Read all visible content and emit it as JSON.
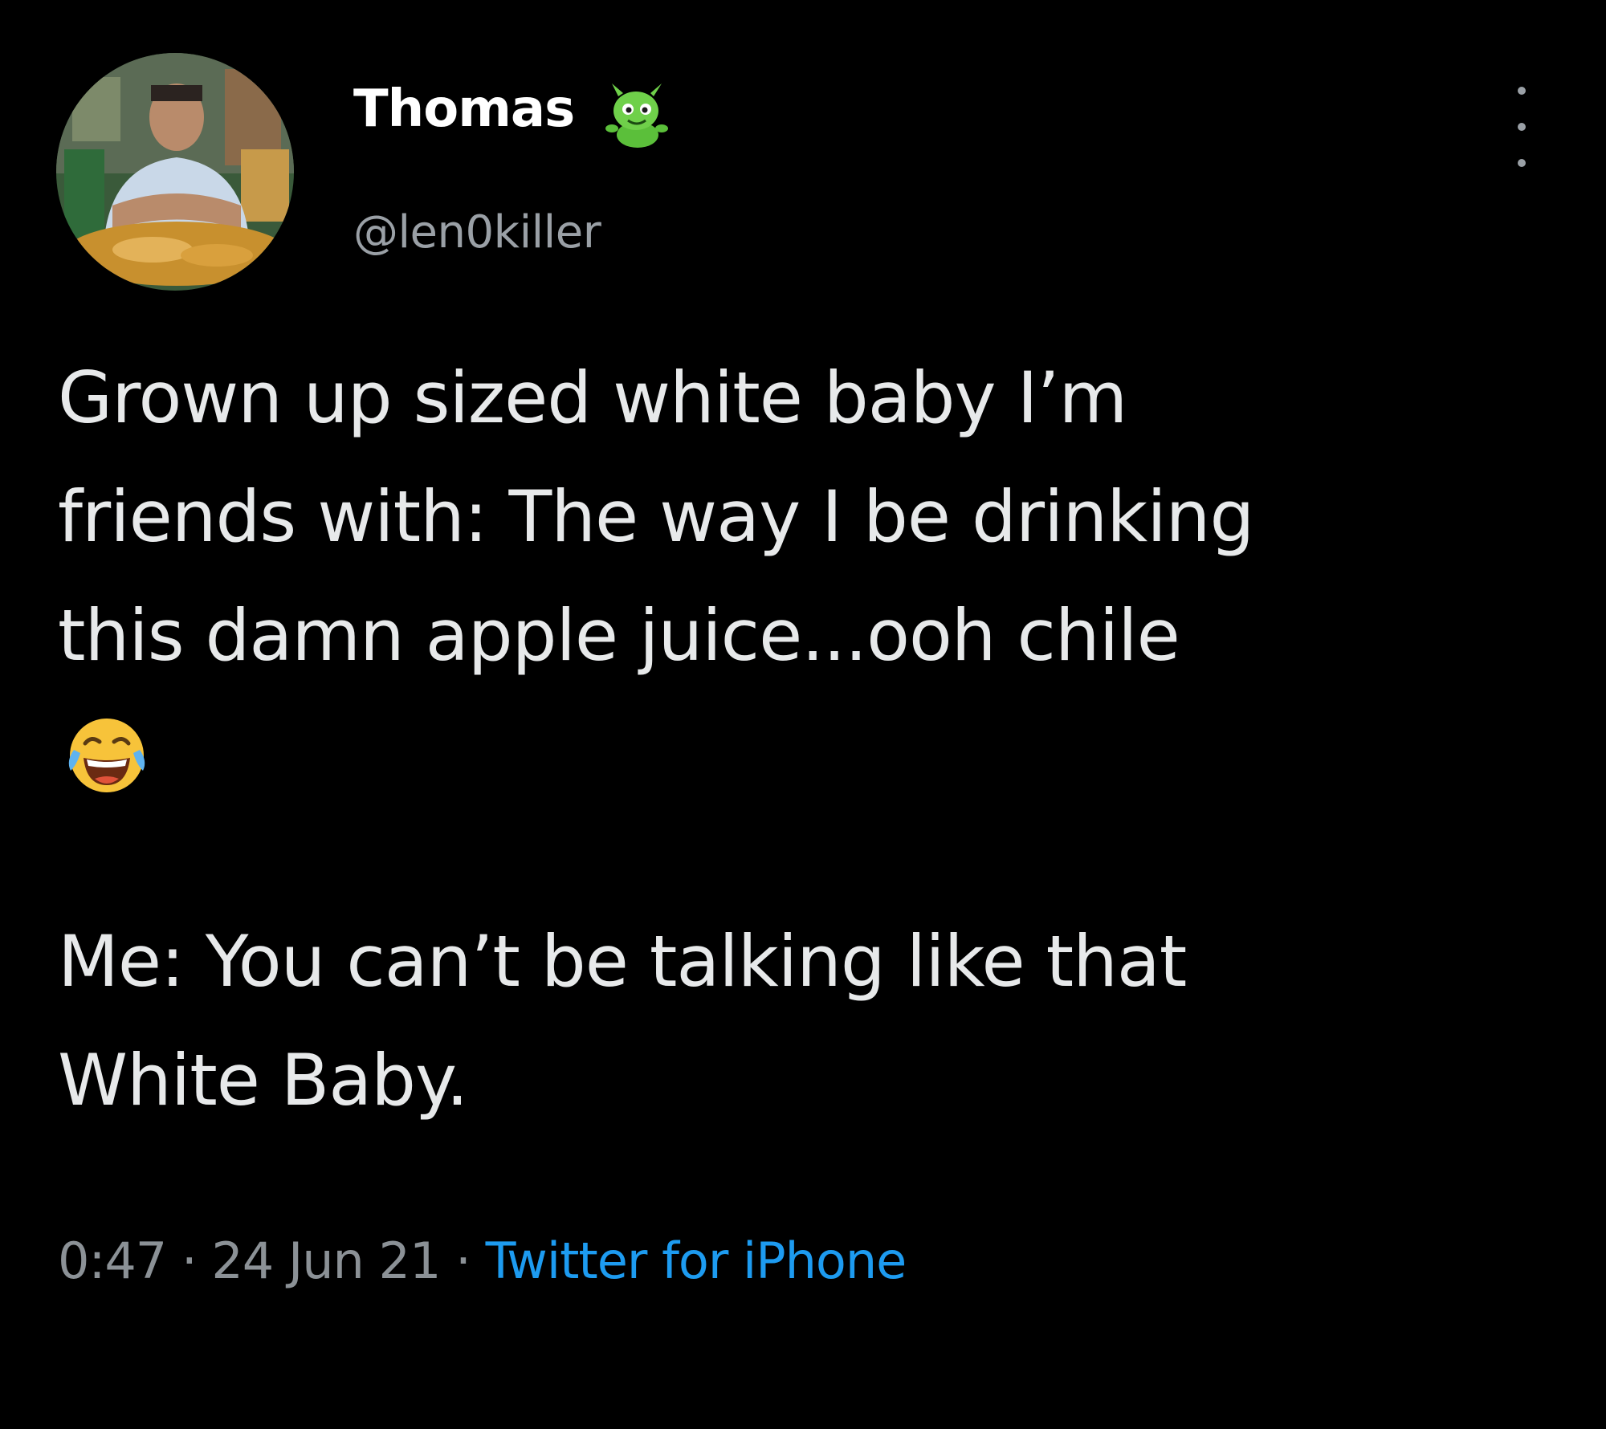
{
  "author": {
    "display_name": "Thomas",
    "handle": "@len0killer",
    "name_emoji": "alien-monster-emoji",
    "avatar": "profile-photo"
  },
  "tweet": {
    "lines_part1": [
      "Grown up sized white baby I’m",
      "friends with: The way I be drinking",
      "this damn apple juice...ooh chile"
    ],
    "emoji": "face-with-tears-of-joy",
    "lines_part2": [
      "Me: You can’t be talking like that",
      "White Baby."
    ]
  },
  "meta": {
    "time": "0:47",
    "separator": " · ",
    "date": "24 Jun 21",
    "source": "Twitter for iPhone"
  },
  "colors": {
    "background": "#000000",
    "text": "#e7e9ea",
    "secondary": "#9aa0a6",
    "link": "#1d9bf0"
  },
  "icons": {
    "more": "vertical-ellipsis-icon"
  }
}
